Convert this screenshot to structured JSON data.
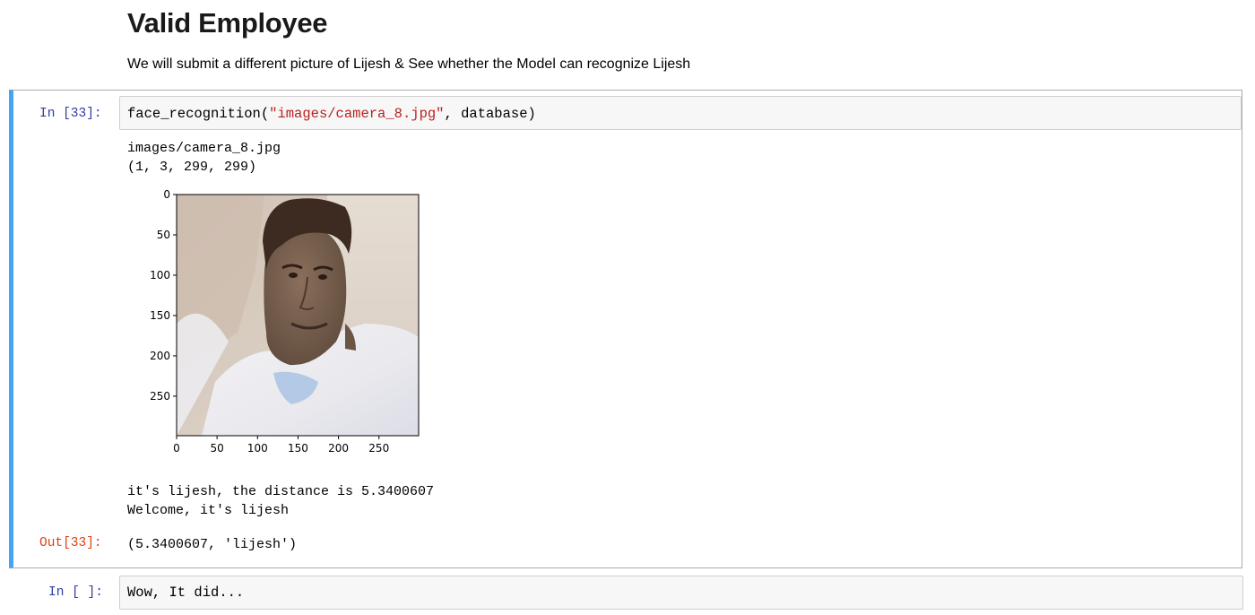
{
  "markdown": {
    "heading": "Valid Employee",
    "paragraph": "We will submit a different picture of Lijesh & See whether the Model can recognize Lijesh"
  },
  "cell_33": {
    "in_prompt": "In [33]:",
    "code_fn": "face_recognition(",
    "code_str": "\"images/camera_8.jpg\"",
    "code_rest": ", database)",
    "stdout_1": "images/camera_8.jpg\n(1, 3, 299, 299)",
    "plot": {
      "y_ticks": [
        "0",
        "50",
        "100",
        "150",
        "200",
        "250"
      ],
      "x_ticks": [
        "0",
        "50",
        "100",
        "150",
        "200",
        "250"
      ],
      "image_extent": [
        0,
        299
      ],
      "image_description_icon": "face-photo"
    },
    "stdout_2": "it's lijesh, the distance is 5.3400607\nWelcome, it's lijesh",
    "out_prompt": "Out[33]:",
    "out_value": "(5.3400607, 'lijesh')"
  },
  "cell_next": {
    "in_prompt": "In [ ]:",
    "code": "Wow, It did..."
  },
  "colors": {
    "selected_bar": "#42a5f5",
    "in_prompt": "#303f9f",
    "out_prompt": "#d84315",
    "string_token": "#ba2121"
  }
}
